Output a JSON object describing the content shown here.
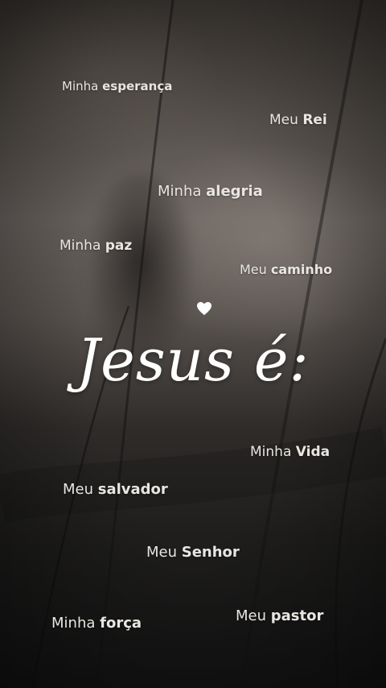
{
  "title": "Jesus é:",
  "phrases": [
    {
      "pre": "Minha",
      "bold": "esperança"
    },
    {
      "pre": "Meu",
      "bold": "Rei"
    },
    {
      "pre": "Minha",
      "bold": "alegria"
    },
    {
      "pre": "Minha",
      "bold": "paz"
    },
    {
      "pre": "Meu",
      "bold": "caminho"
    },
    {
      "pre": "Minha",
      "bold": "Vida"
    },
    {
      "pre": "Meu",
      "bold": "salvador"
    },
    {
      "pre": "Meu",
      "bold": "Senhor"
    },
    {
      "pre": "Minha",
      "bold": "força"
    },
    {
      "pre": "Meu",
      "bold": "pastor"
    }
  ],
  "icons": {
    "heart": "heart-icon"
  }
}
